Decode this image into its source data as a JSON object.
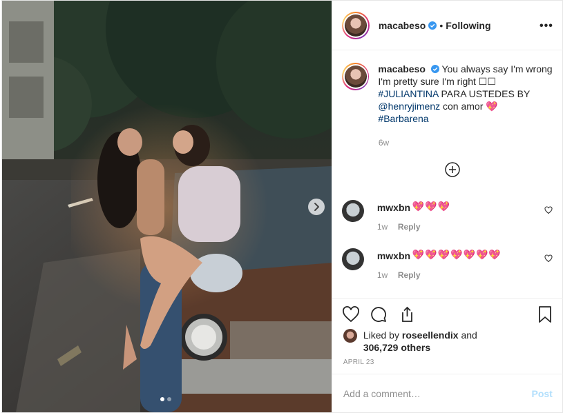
{
  "header": {
    "username": "macabeso",
    "separator": "•",
    "follow_status": "Following",
    "more_label": "•••"
  },
  "caption": {
    "username": "macabeso",
    "text_1": "You always say I'm wrong I'm pretty sure I'm right ☐☐",
    "hashtag_1": "#JULIANTINA",
    "text_2": " PARA USTEDES BY ",
    "mention": "@henryjimenz",
    "text_3": " con amor 💖",
    "hashtag_2": "#Barbarena",
    "time_ago": "6w"
  },
  "comments": [
    {
      "username": "mwxbn",
      "text": "💖💖💖",
      "time_ago": "1w",
      "reply_label": "Reply"
    },
    {
      "username": "mwxbn",
      "text": "💖💖💖💖💖💖💖",
      "time_ago": "1w",
      "reply_label": "Reply"
    }
  ],
  "likes": {
    "prefix": "Liked by ",
    "first_user": "roseellendix",
    "middle": " and",
    "others": "306,729 others"
  },
  "date": "APRIL 23",
  "add_comment": {
    "placeholder": "Add a comment…",
    "post_label": "Post"
  },
  "carousel": {
    "slide_count": 2,
    "active_index": 0
  },
  "colors": {
    "link": "#00376b",
    "muted": "#8e8e8e",
    "post_disabled": "#b2dffc",
    "verified_blue": "#3897f0"
  }
}
